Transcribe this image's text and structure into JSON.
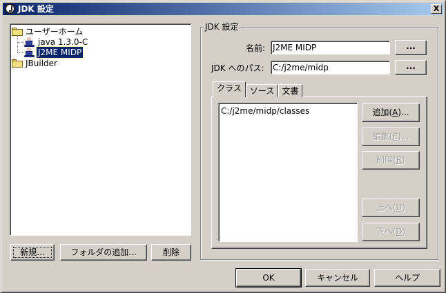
{
  "window": {
    "title": "JDK 設定",
    "close_label": "X"
  },
  "tree": {
    "items": [
      {
        "label": "ユーザーホーム",
        "icon": "folder-icon"
      },
      {
        "label": "java 1.3.0-C",
        "icon": "java-cup-icon"
      },
      {
        "label": "J2ME MIDP",
        "icon": "java-cup-icon",
        "selected": true
      },
      {
        "label": "JBuilder",
        "icon": "folder-icon"
      }
    ]
  },
  "left_buttons": {
    "new": "新規...",
    "add_folder": "フォルダの追加...",
    "delete": "削除"
  },
  "jdk_settings": {
    "group_label": "JDK 設定",
    "name_label": "名前:",
    "name_value": "J2ME MIDP",
    "path_label": "JDK へのパス:",
    "path_value": "C:/j2me/midp",
    "browse_label": "..."
  },
  "tabs": [
    {
      "label": "クラス",
      "active": true
    },
    {
      "label": "ソース",
      "active": false
    },
    {
      "label": "文書",
      "active": false
    }
  ],
  "class_list": [
    "C:/j2me/midp/classes"
  ],
  "side_buttons": {
    "add": {
      "text": "追加",
      "mnemonic": "A",
      "suffix": "..."
    },
    "edit": {
      "text": "編集",
      "mnemonic": "E",
      "suffix": "..."
    },
    "remove": {
      "text": "削除",
      "mnemonic": "R",
      "suffix": ""
    },
    "move_up": {
      "text": "上へ",
      "mnemonic": "U",
      "suffix": ""
    },
    "move_down": {
      "text": "下へ",
      "mnemonic": "D",
      "suffix": ""
    }
  },
  "dialog_buttons": {
    "ok": "OK",
    "cancel": "キャンセル",
    "help": "ヘルプ"
  },
  "colors": {
    "title_bar": "#0a246a",
    "selection": "#0a246a",
    "dialog_face": "#d4d0c8"
  }
}
